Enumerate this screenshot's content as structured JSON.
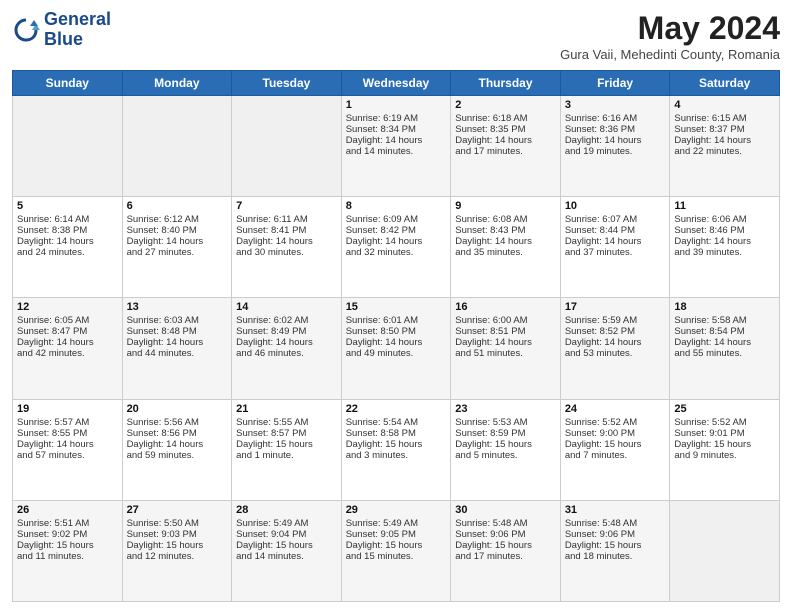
{
  "header": {
    "logo_line1": "General",
    "logo_line2": "Blue",
    "month_year": "May 2024",
    "location": "Gura Vaii, Mehedinti County, Romania"
  },
  "days_of_week": [
    "Sunday",
    "Monday",
    "Tuesday",
    "Wednesday",
    "Thursday",
    "Friday",
    "Saturday"
  ],
  "weeks": [
    [
      {
        "day": "",
        "text": ""
      },
      {
        "day": "",
        "text": ""
      },
      {
        "day": "",
        "text": ""
      },
      {
        "day": "1",
        "text": "Sunrise: 6:19 AM\nSunset: 8:34 PM\nDaylight: 14 hours\nand 14 minutes."
      },
      {
        "day": "2",
        "text": "Sunrise: 6:18 AM\nSunset: 8:35 PM\nDaylight: 14 hours\nand 17 minutes."
      },
      {
        "day": "3",
        "text": "Sunrise: 6:16 AM\nSunset: 8:36 PM\nDaylight: 14 hours\nand 19 minutes."
      },
      {
        "day": "4",
        "text": "Sunrise: 6:15 AM\nSunset: 8:37 PM\nDaylight: 14 hours\nand 22 minutes."
      }
    ],
    [
      {
        "day": "5",
        "text": "Sunrise: 6:14 AM\nSunset: 8:38 PM\nDaylight: 14 hours\nand 24 minutes."
      },
      {
        "day": "6",
        "text": "Sunrise: 6:12 AM\nSunset: 8:40 PM\nDaylight: 14 hours\nand 27 minutes."
      },
      {
        "day": "7",
        "text": "Sunrise: 6:11 AM\nSunset: 8:41 PM\nDaylight: 14 hours\nand 30 minutes."
      },
      {
        "day": "8",
        "text": "Sunrise: 6:09 AM\nSunset: 8:42 PM\nDaylight: 14 hours\nand 32 minutes."
      },
      {
        "day": "9",
        "text": "Sunrise: 6:08 AM\nSunset: 8:43 PM\nDaylight: 14 hours\nand 35 minutes."
      },
      {
        "day": "10",
        "text": "Sunrise: 6:07 AM\nSunset: 8:44 PM\nDaylight: 14 hours\nand 37 minutes."
      },
      {
        "day": "11",
        "text": "Sunrise: 6:06 AM\nSunset: 8:46 PM\nDaylight: 14 hours\nand 39 minutes."
      }
    ],
    [
      {
        "day": "12",
        "text": "Sunrise: 6:05 AM\nSunset: 8:47 PM\nDaylight: 14 hours\nand 42 minutes."
      },
      {
        "day": "13",
        "text": "Sunrise: 6:03 AM\nSunset: 8:48 PM\nDaylight: 14 hours\nand 44 minutes."
      },
      {
        "day": "14",
        "text": "Sunrise: 6:02 AM\nSunset: 8:49 PM\nDaylight: 14 hours\nand 46 minutes."
      },
      {
        "day": "15",
        "text": "Sunrise: 6:01 AM\nSunset: 8:50 PM\nDaylight: 14 hours\nand 49 minutes."
      },
      {
        "day": "16",
        "text": "Sunrise: 6:00 AM\nSunset: 8:51 PM\nDaylight: 14 hours\nand 51 minutes."
      },
      {
        "day": "17",
        "text": "Sunrise: 5:59 AM\nSunset: 8:52 PM\nDaylight: 14 hours\nand 53 minutes."
      },
      {
        "day": "18",
        "text": "Sunrise: 5:58 AM\nSunset: 8:54 PM\nDaylight: 14 hours\nand 55 minutes."
      }
    ],
    [
      {
        "day": "19",
        "text": "Sunrise: 5:57 AM\nSunset: 8:55 PM\nDaylight: 14 hours\nand 57 minutes."
      },
      {
        "day": "20",
        "text": "Sunrise: 5:56 AM\nSunset: 8:56 PM\nDaylight: 14 hours\nand 59 minutes."
      },
      {
        "day": "21",
        "text": "Sunrise: 5:55 AM\nSunset: 8:57 PM\nDaylight: 15 hours\nand 1 minute."
      },
      {
        "day": "22",
        "text": "Sunrise: 5:54 AM\nSunset: 8:58 PM\nDaylight: 15 hours\nand 3 minutes."
      },
      {
        "day": "23",
        "text": "Sunrise: 5:53 AM\nSunset: 8:59 PM\nDaylight: 15 hours\nand 5 minutes."
      },
      {
        "day": "24",
        "text": "Sunrise: 5:52 AM\nSunset: 9:00 PM\nDaylight: 15 hours\nand 7 minutes."
      },
      {
        "day": "25",
        "text": "Sunrise: 5:52 AM\nSunset: 9:01 PM\nDaylight: 15 hours\nand 9 minutes."
      }
    ],
    [
      {
        "day": "26",
        "text": "Sunrise: 5:51 AM\nSunset: 9:02 PM\nDaylight: 15 hours\nand 11 minutes."
      },
      {
        "day": "27",
        "text": "Sunrise: 5:50 AM\nSunset: 9:03 PM\nDaylight: 15 hours\nand 12 minutes."
      },
      {
        "day": "28",
        "text": "Sunrise: 5:49 AM\nSunset: 9:04 PM\nDaylight: 15 hours\nand 14 minutes."
      },
      {
        "day": "29",
        "text": "Sunrise: 5:49 AM\nSunset: 9:05 PM\nDaylight: 15 hours\nand 15 minutes."
      },
      {
        "day": "30",
        "text": "Sunrise: 5:48 AM\nSunset: 9:06 PM\nDaylight: 15 hours\nand 17 minutes."
      },
      {
        "day": "31",
        "text": "Sunrise: 5:48 AM\nSunset: 9:06 PM\nDaylight: 15 hours\nand 18 minutes."
      },
      {
        "day": "",
        "text": ""
      }
    ]
  ]
}
